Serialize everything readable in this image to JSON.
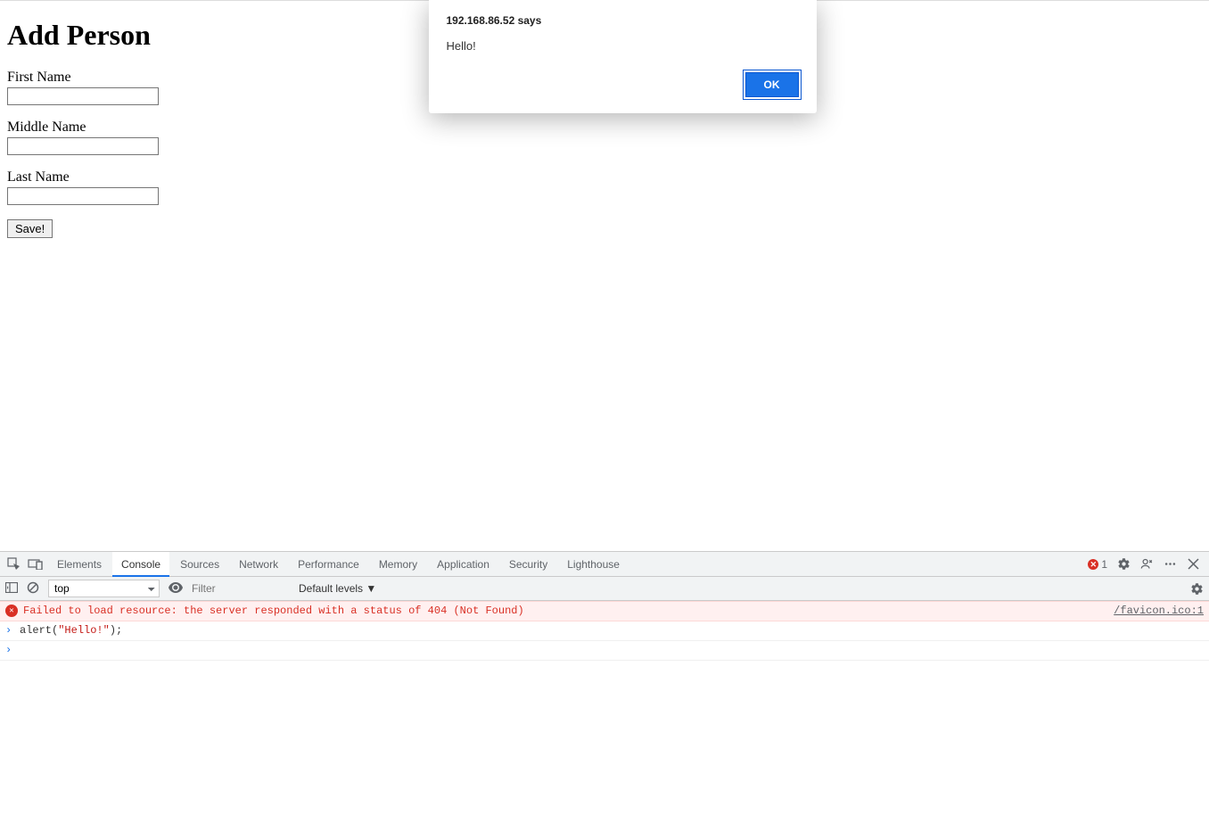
{
  "page": {
    "heading": "Add Person",
    "fields": {
      "first_name": {
        "label": "First Name",
        "value": ""
      },
      "middle_name": {
        "label": "Middle Name",
        "value": ""
      },
      "last_name": {
        "label": "Last Name",
        "value": ""
      }
    },
    "save_label": "Save!"
  },
  "alert": {
    "origin_text": "192.168.86.52 says",
    "message": "Hello!",
    "ok_label": "OK"
  },
  "devtools": {
    "tabs": [
      "Elements",
      "Console",
      "Sources",
      "Network",
      "Performance",
      "Memory",
      "Application",
      "Security",
      "Lighthouse"
    ],
    "active_tab": "Console",
    "error_count": "1",
    "toolbar": {
      "context": "top",
      "filter_placeholder": "Filter",
      "levels_label": "Default levels ▼"
    },
    "console": {
      "error_message": "Failed to load resource: the server responded with a status of 404 (Not Found)",
      "error_source": "/favicon.ico:1",
      "command_prefix": "alert(",
      "command_string": "\"Hello!\"",
      "command_suffix": ");"
    }
  }
}
